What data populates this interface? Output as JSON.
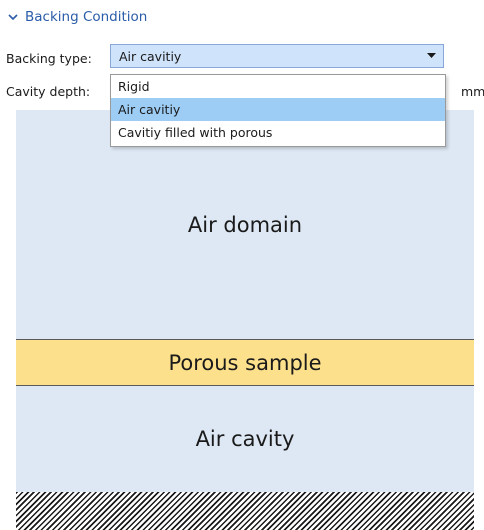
{
  "section": {
    "title": "Backing Condition",
    "icon": "chevron-down-icon",
    "accent_color": "#2a5ca8"
  },
  "form": {
    "backing_type_label": "Backing type:",
    "backing_type_value": "Air cavitiy",
    "cavity_depth_label": "Cavity depth:",
    "cavity_depth_unit": "mm"
  },
  "dropdown": {
    "options": [
      "Rigid",
      "Air cavitiy",
      "Cavitiy filled with porous"
    ],
    "selected_index": 1,
    "highlight_color": "#9dcdf5"
  },
  "diagram": {
    "air_domain": "Air domain",
    "porous_sample": "Porous sample",
    "air_cavity": "Air cavity",
    "air_color": "#dde8f4",
    "porous_color": "#fde08c",
    "rigid_wall": "hatched-wall"
  }
}
